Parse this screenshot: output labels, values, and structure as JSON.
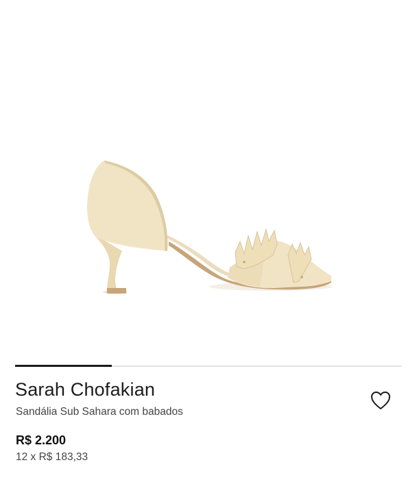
{
  "product": {
    "brand": "Sarah Chofakian",
    "name": "Sandália Sub Sahara com babados",
    "price": "R$ 2.200",
    "installments": "12 x R$ 183,33",
    "favorite_icon": "heart-outline-icon"
  },
  "gallery": {
    "progress": 0.25
  },
  "colors": {
    "shoe_main": "#f1e4c4",
    "shoe_shadow": "#dccca3",
    "heel": "#e9d8b0",
    "sole": "#c7a57a",
    "text_dark": "#1a1a1a",
    "text_secondary": "#444444",
    "track": "#e2e2e2"
  }
}
